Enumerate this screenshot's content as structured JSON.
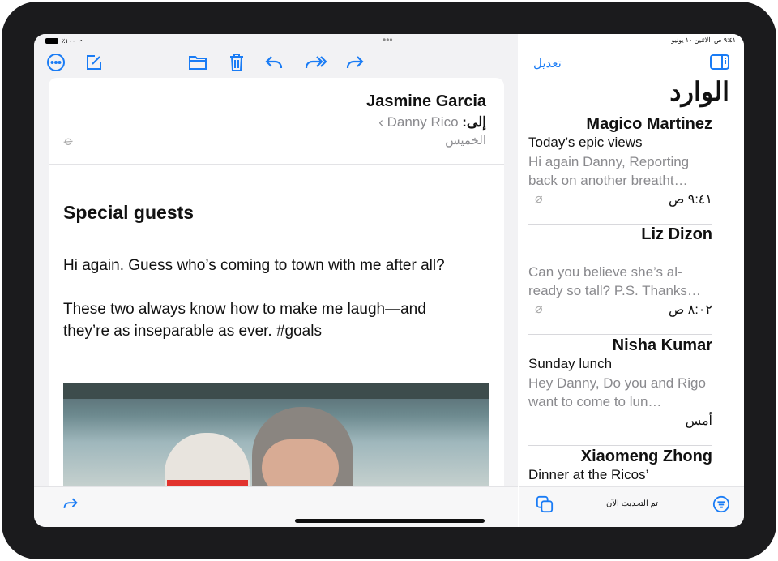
{
  "status": {
    "time": "٩:٤١ ص",
    "date": "الاثنين ١٠ يونيو",
    "battery": "٪١٠٠"
  },
  "toolbar": {
    "more": "more-icon",
    "compose": "compose-icon",
    "folder": "folder-icon",
    "trash": "trash-icon",
    "reply": "reply-icon",
    "reply_all": "reply-all-icon",
    "forward": "forward-icon"
  },
  "message": {
    "from": "Jasmine Garcia",
    "to_label": "إلى:",
    "to": "Danny Rico",
    "date": "الخميس",
    "subject": "Special guests",
    "body": [
      "Hi again. Guess who’s coming to town with me after all?",
      "These two always know how to make me laugh—and they’re as inseparable as ever. #goals"
    ]
  },
  "inbox": {
    "edit": "تعديل",
    "title": "الوارد",
    "status": "تم التحديث الآن",
    "items": [
      {
        "sender": "Magico Martinez",
        "subject": "Today’s epic views",
        "preview": "Hi again Danny, Reporting back on another breatht…",
        "time": "٩:٤١ ص",
        "attachment": true
      },
      {
        "sender": "Liz Dizon",
        "subject": "",
        "preview": "Can you believe she’s al-ready so tall? P.S. Thanks…",
        "time": "٨:٠٢ ص",
        "attachment": true
      },
      {
        "sender": "Nisha Kumar",
        "subject": "Sunday lunch",
        "preview": "Hey Danny, Do you and Rigo want to come to lun…",
        "time": "أمس",
        "attachment": false
      },
      {
        "sender": "Xiaomeng Zhong",
        "subject": "Dinner at the Ricos’",
        "preview": "",
        "time": "",
        "attachment": false
      }
    ]
  },
  "colors": {
    "accent": "#1a7cf5"
  }
}
